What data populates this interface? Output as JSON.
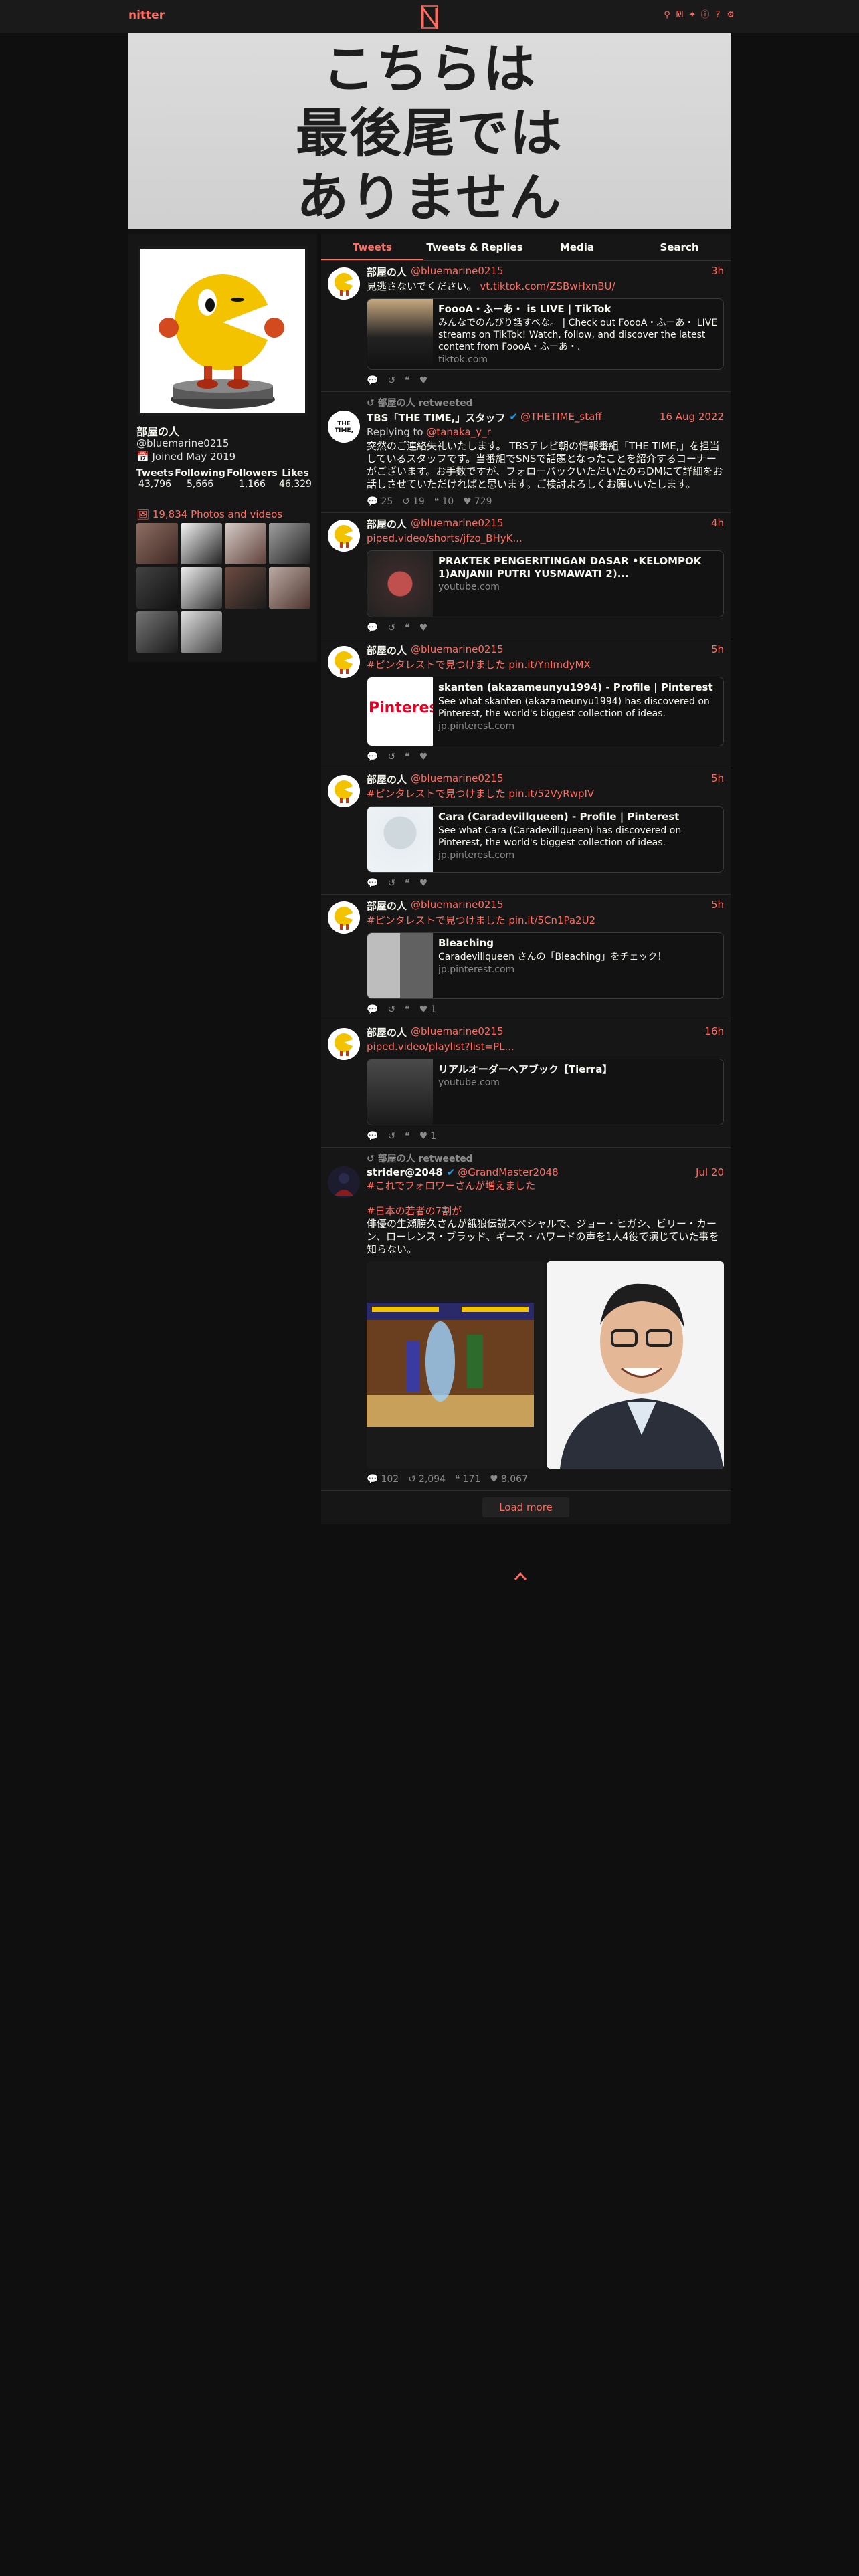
{
  "nav": {
    "logo": "nitter",
    "icons": [
      "search-icon",
      "rss-icon",
      "twitter-icon",
      "info-icon",
      "help-icon",
      "settings-icon"
    ]
  },
  "banner": {
    "lines": [
      "こちらは",
      "最後尾では",
      "ありません"
    ]
  },
  "profile": {
    "name": "部屋の人",
    "username": "@bluemarine0215",
    "joined": "Joined May 2019",
    "stats": [
      {
        "label": "Tweets",
        "value": "43,796"
      },
      {
        "label": "Following",
        "value": "5,666"
      },
      {
        "label": "Followers",
        "value": "1,166"
      },
      {
        "label": "Likes",
        "value": "46,329"
      }
    ],
    "media_link": "19,834 Photos and videos"
  },
  "tabs": [
    "Tweets",
    "Tweets & Replies",
    "Media",
    "Search"
  ],
  "tweets": [
    {
      "name": "部屋の人",
      "user": "@bluemarine0215",
      "date": "3h",
      "body": "見逃さないでください。",
      "link": "vt.tiktok.com/ZSBwHxnBU/",
      "card": {
        "title": "FoooA・ふーあ・ is LIVE | TikTok",
        "desc": "みんなでのんびり話すべな。 | Check out FoooA・ふーあ・ LIVE streams on TikTok! Watch, follow, and discover the latest content from FoooA・ふーあ・.",
        "dest": "tiktok.com"
      },
      "stats": [
        "",
        "",
        "",
        ""
      ]
    },
    {
      "retweet": "部屋の人 retweeted",
      "name": "TBS「THE TIME,」スタッフ",
      "user": "@THETIME_staff",
      "date": "16 Aug 2022",
      "reply_prefix": "Replying to ",
      "reply_to": "@tanaka_y_r",
      "body": "突然のご連絡失礼いたします。 TBSテレビ朝の情報番組「THE TIME,」を担当しているスタッフです。当番組でSNSで話題となったことを紹介するコーナーがございます。お手数ですが、フォローバックいただいたのちDMにて詳細をお話しさせていただければと思います。ご検討よろしくお願いいたします。",
      "stats": [
        "25",
        "19",
        "10",
        "729"
      ]
    },
    {
      "name": "部屋の人",
      "user": "@bluemarine0215",
      "date": "4h",
      "link": "piped.video/shorts/jfzo_BHyK...",
      "card": {
        "title": "PRAKTEK PENGERITINGAN DASAR •KELOMPOK 1)ANJANII PUTRI YUSMAWATI 2)...",
        "desc": "",
        "dest": "youtube.com"
      },
      "stats": [
        "",
        "",
        "",
        ""
      ]
    },
    {
      "name": "部屋の人",
      "user": "@bluemarine0215",
      "date": "5h",
      "hashtag": "#ピンタレストで見つけました",
      "link": "pin.it/YnImdyMX",
      "card": {
        "title": "skanten (akazameunyu1994) - Profile | Pinterest",
        "desc": "See what skanten (akazameunyu1994) has discovered on Pinterest, the world's biggest collection of ideas.",
        "dest": "jp.pinterest.com"
      },
      "stats": [
        "",
        "",
        "",
        ""
      ]
    },
    {
      "name": "部屋の人",
      "user": "@bluemarine0215",
      "date": "5h",
      "hashtag": "#ピンタレストで見つけました",
      "link": "pin.it/52VyRwpIV",
      "card": {
        "title": "Cara (Caradevillqueen) - Profile | Pinterest",
        "desc": "See what Cara (Caradevillqueen) has discovered on Pinterest, the world's biggest collection of ideas.",
        "dest": "jp.pinterest.com"
      },
      "stats": [
        "",
        "",
        "",
        ""
      ]
    },
    {
      "name": "部屋の人",
      "user": "@bluemarine0215",
      "date": "5h",
      "hashtag": "#ピンタレストで見つけました",
      "link": "pin.it/5Cn1Pa2U2",
      "card": {
        "title": "Bleaching",
        "desc": "Caradevillqueen さんの「Bleaching」をチェック！",
        "dest": "jp.pinterest.com"
      },
      "stats": [
        "",
        "",
        "",
        "1"
      ]
    },
    {
      "name": "部屋の人",
      "user": "@bluemarine0215",
      "date": "16h",
      "link": "piped.video/playlist?list=PL...",
      "card": {
        "title": "リアルオーダーヘアブック【Tierra】",
        "desc": "",
        "dest": "youtube.com"
      },
      "stats": [
        "",
        "",
        "",
        "1"
      ]
    },
    {
      "retweet": "部屋の人 retweeted",
      "name": "strider@2048",
      "user": "@GrandMaster2048",
      "date": "Jul 20",
      "hashtag": "#これでフォロワーさんが増えました",
      "hashtag2": "#日本の若者の7割が",
      "body": "俳優の生瀬勝久さんが餓狼伝説スペシャルで、ジョー・ヒガシ、ビリー・カーン、ローレンス・ブラッド、ギース・ハワードの声を1人4役で演じていた事を知らない。",
      "stats": [
        "102",
        "2,094",
        "171",
        "8,067"
      ]
    }
  ],
  "load_more": "Load more",
  "colors": {
    "accent": "#ff6c60",
    "bg": "#0f0f0f",
    "panel": "#161616"
  }
}
